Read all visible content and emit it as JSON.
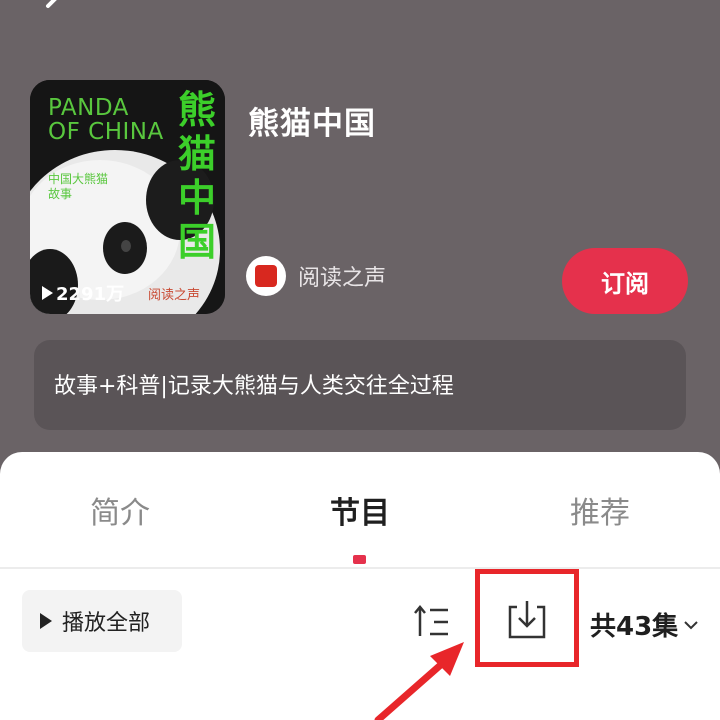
{
  "album": {
    "title": "熊猫中国",
    "play_count": "2291万",
    "cover": {
      "title_en": "PANDA OF CHINA",
      "subtitle": "中国大熊猫故事",
      "title_cn": "熊猫中国",
      "seal": "阅读之声"
    }
  },
  "publisher": {
    "name": "阅读之声"
  },
  "subscribe": {
    "label": "订阅"
  },
  "description": "故事+科普|记录大熊猫与人类交往全过程",
  "tabs": [
    {
      "label": "简介",
      "active": false
    },
    {
      "label": "节目",
      "active": true
    },
    {
      "label": "推荐",
      "active": false
    }
  ],
  "toolbar": {
    "play_all_label": "播放全部",
    "episode_count": "共43集"
  },
  "colors": {
    "accent": "#e5314c",
    "header_bg": "#6a6366",
    "annotation": "#e8262a"
  },
  "icons": [
    "back-icon",
    "play-icon",
    "sort-icon",
    "download-icon",
    "chevron-down-icon"
  ]
}
